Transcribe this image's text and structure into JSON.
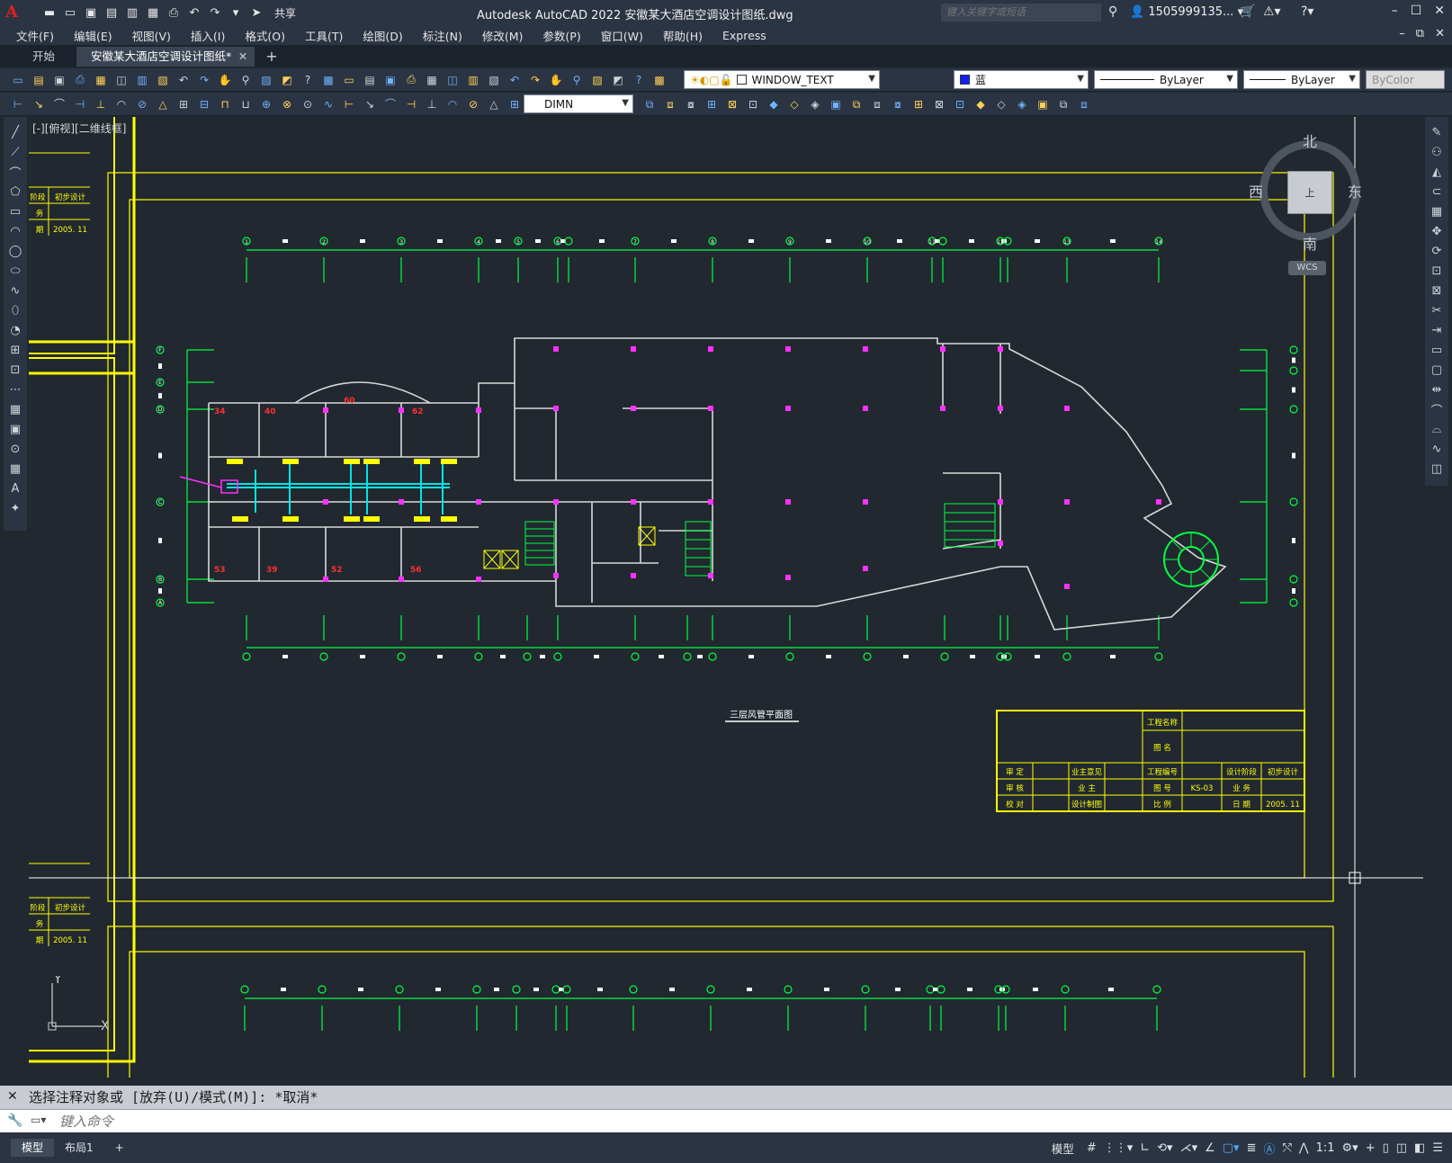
{
  "app": {
    "title": "Autodesk AutoCAD 2022    安徽某大酒店空调设计图纸.dwg",
    "logo": "A",
    "share_label": "共享",
    "search_placeholder": "键入关键字或短语",
    "user_name": "1505999135...",
    "accent_color": "#e02020"
  },
  "menu": {
    "items": [
      "文件(F)",
      "编辑(E)",
      "视图(V)",
      "插入(I)",
      "格式(O)",
      "工具(T)",
      "绘图(D)",
      "标注(N)",
      "修改(M)",
      "参数(P)",
      "窗口(W)",
      "帮助(H)",
      "Express"
    ]
  },
  "tabs": {
    "start": "开始",
    "active": "安徽某大酒店空调设计图纸*",
    "close_glyph": "✕",
    "plus": "+"
  },
  "toolbar1": {
    "layer_name": "WINDOW_TEXT",
    "color_name": "蓝",
    "color_swatch": "#1020ff",
    "linetype": "ByLayer",
    "lineweight": "ByLayer",
    "plotstyle": "ByColor"
  },
  "toolbar2": {
    "dimstyle": "DIMN"
  },
  "viewport": {
    "label": "[-][俯视][二维线框]"
  },
  "viewcube": {
    "north": "北",
    "south": "南",
    "east": "东",
    "west": "西",
    "face": "上",
    "wcs": "WCS"
  },
  "drawing": {
    "plan_title": "三层风管平面图",
    "axis_top_labels": [
      "1",
      "2",
      "3",
      "4",
      "5",
      "6",
      "7",
      "8",
      "9",
      "10",
      "11",
      "12",
      "13",
      "14"
    ],
    "axis_side_labels": [
      "F",
      "E",
      "D",
      "C",
      "B",
      "A"
    ],
    "room_numbers": [
      "60",
      "34",
      "40",
      "62",
      "53",
      "39",
      "52",
      "56"
    ],
    "title_block": {
      "project_name_label": "工程名称",
      "drawing_name_label": "图    名",
      "approve": "审    定",
      "review": "审    核",
      "check": "校    对",
      "owner_opinion": "业主意见",
      "owner": "业    主",
      "design_drawing": "设计制图",
      "project_no_label": "工程编号",
      "drawing_no_label": "图    号",
      "drawing_no": "KS-03",
      "scale_label": "比    例",
      "design_stage_label": "设计阶段",
      "design_stage": "初步设计",
      "service_label": "业    务",
      "date_label": "日    期",
      "date": "2005. 11"
    },
    "left_block": {
      "stage": "阶段",
      "stage_value": "初步设计",
      "service": "务",
      "date_label": "期",
      "date": "2005. 11"
    }
  },
  "ucs": {
    "x": "X",
    "y": "Y"
  },
  "command": {
    "history": "选择注释对象或 [放弃(U)/模式(M)]: *取消*",
    "placeholder": "键入命令",
    "close_glyph": "✕"
  },
  "status": {
    "layout_tabs": [
      "模型",
      "布局1"
    ],
    "plus": "+",
    "mode": "模型",
    "scale": "1:1"
  }
}
